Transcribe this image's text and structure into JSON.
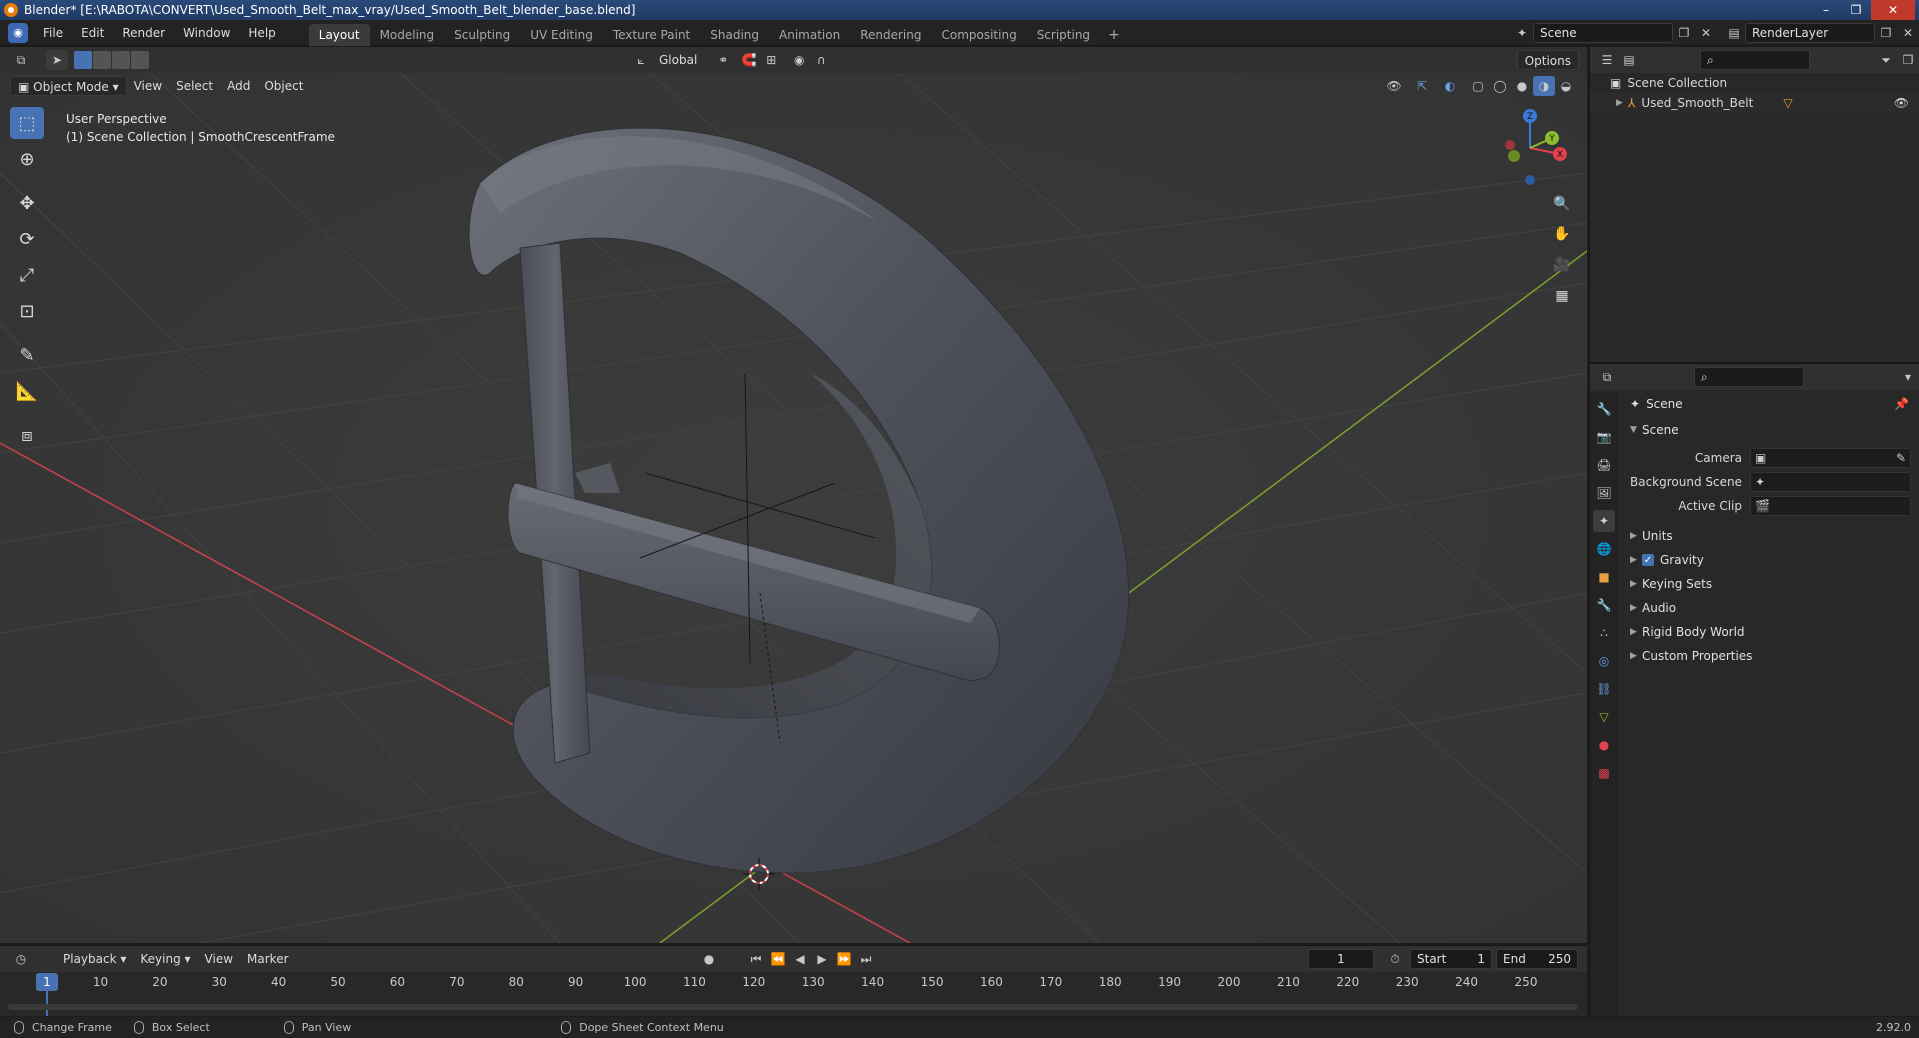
{
  "window": {
    "title": "Blender* [E:\\RABOTA\\CONVERT\\Used_Smooth_Belt_max_vray/Used_Smooth_Belt_blender_base.blend]",
    "minimize": "–",
    "maximize": "❐",
    "close": "✕"
  },
  "menu": {
    "items": [
      "File",
      "Edit",
      "Render",
      "Window",
      "Help"
    ]
  },
  "workspaces": {
    "tabs": [
      "Layout",
      "Modeling",
      "Sculpting",
      "UV Editing",
      "Texture Paint",
      "Shading",
      "Animation",
      "Rendering",
      "Compositing",
      "Scripting"
    ],
    "active": "Layout",
    "add": "+"
  },
  "topright": {
    "scene": "Scene",
    "render_layer": "RenderLayer"
  },
  "viewport_header": {
    "transform_orientation": "Global",
    "options": "Options",
    "mode": "Object Mode",
    "menus": [
      "View",
      "Select",
      "Add",
      "Object"
    ]
  },
  "viewport": {
    "perspective": "User Perspective",
    "collection_info": "(1) Scene Collection | SmoothCrescentFrame",
    "gizmo": {
      "x": "X",
      "y": "Y",
      "z": "Z"
    }
  },
  "outliner": {
    "root": "Scene Collection",
    "item": "Used_Smooth_Belt"
  },
  "properties": {
    "header": "Scene",
    "panel": "Scene",
    "fields": [
      {
        "label": "Camera",
        "value": ""
      },
      {
        "label": "Background Scene",
        "value": ""
      },
      {
        "label": "Active Clip",
        "value": ""
      }
    ],
    "sections": [
      "Units",
      "Gravity",
      "Keying Sets",
      "Audio",
      "Rigid Body World",
      "Custom Properties"
    ],
    "gravity_checked": true
  },
  "timeline": {
    "menus": [
      "Playback",
      "Keying",
      "View",
      "Marker"
    ],
    "current_frame": "1",
    "start_label": "Start",
    "start": "1",
    "end_label": "End",
    "end": "250",
    "frame_labels": [
      "1",
      "10",
      "20",
      "30",
      "40",
      "50",
      "60",
      "70",
      "80",
      "90",
      "100",
      "110",
      "120",
      "130",
      "140",
      "150",
      "160",
      "170",
      "180",
      "190",
      "200",
      "210",
      "220",
      "230",
      "240",
      "250"
    ]
  },
  "statusbar": {
    "items": [
      "Change Frame",
      "Box Select",
      "Pan View",
      "Dope Sheet Context Menu"
    ],
    "version": "2.92.0"
  },
  "colors": {
    "accent": "#4772b3",
    "x_axis": "#e2414f",
    "y_axis": "#8dbb2e",
    "z_axis": "#3d7ad6",
    "viewport_bg": "#393939"
  }
}
